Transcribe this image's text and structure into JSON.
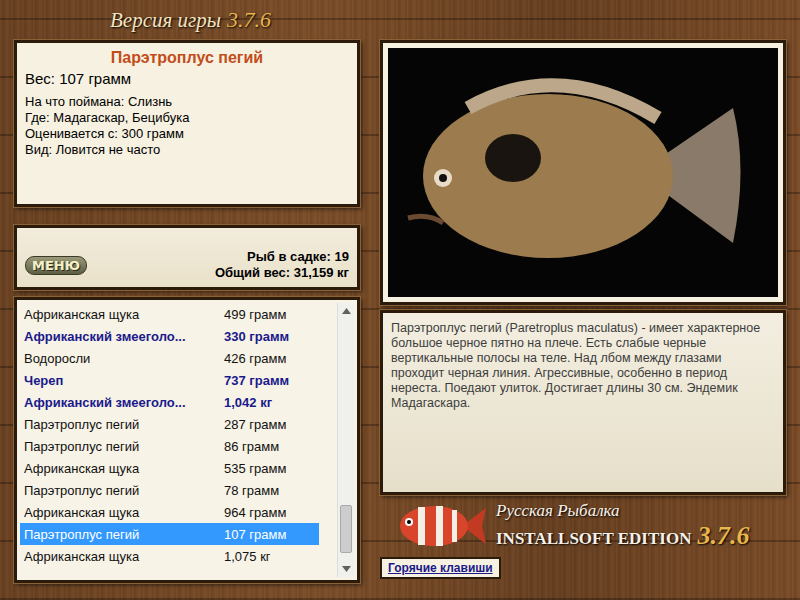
{
  "version": {
    "label": "Версия игры",
    "number": "3.7.6"
  },
  "fish_card": {
    "name": "Парэтроплус пегий",
    "weight": "Вес: 107 грамм",
    "details": [
      "На что поймана: Слизнь",
      "Где: Мадагаскар, Бецибука",
      "Оценивается с: 300 грамм",
      "Вид: Ловится не часто"
    ]
  },
  "menu_button": "МЕНЮ",
  "keepnet": {
    "count": "Рыб в садке: 19",
    "total": "Общий вес: 31,159 кг"
  },
  "catch_list": {
    "rows": [
      {
        "name": "Африканская щука",
        "weight": "499 грамм",
        "bold": false,
        "selected": false
      },
      {
        "name": "Африканский змееголо...",
        "weight": "330 грамм",
        "bold": true,
        "selected": false
      },
      {
        "name": "Водоросли",
        "weight": "426 грамм",
        "bold": false,
        "selected": false
      },
      {
        "name": "Череп",
        "weight": "737 грамм",
        "bold": true,
        "selected": false
      },
      {
        "name": "Африканский змееголо...",
        "weight": "1,042 кг",
        "bold": true,
        "selected": false
      },
      {
        "name": "Парэтроплус пегий",
        "weight": "287 грамм",
        "bold": false,
        "selected": false
      },
      {
        "name": "Парэтроплус пегий",
        "weight": "86 грамм",
        "bold": false,
        "selected": false
      },
      {
        "name": "Африканская щука",
        "weight": "535 грамм",
        "bold": false,
        "selected": false
      },
      {
        "name": "Парэтроплус пегий",
        "weight": "78 грамм",
        "bold": false,
        "selected": false
      },
      {
        "name": "Африканская щука",
        "weight": "964 грамм",
        "bold": false,
        "selected": false
      },
      {
        "name": "Парэтроплус пегий",
        "weight": "107 грамм",
        "bold": false,
        "selected": true
      },
      {
        "name": "Африканская щука",
        "weight": "1,075 кг",
        "bold": false,
        "selected": false
      }
    ]
  },
  "description": "Парэтроплус пегий (Paretroplus maculatus) - имеет характерное большое черное пятно на плече. Есть слабые черные вертикальные полосы на теле. Над лбом между глазами проходит черная линия. Агрессивные, особенно в период нереста. Поедают улиток. Достигает длины 30 см. Эндемик Мадагаскара.",
  "logo": {
    "title": "Русская Рыбалка",
    "edition": "INSTALLSOFT EDITION",
    "version": "3.7.6"
  },
  "hotkeys_button": "Горячие клавиши"
}
